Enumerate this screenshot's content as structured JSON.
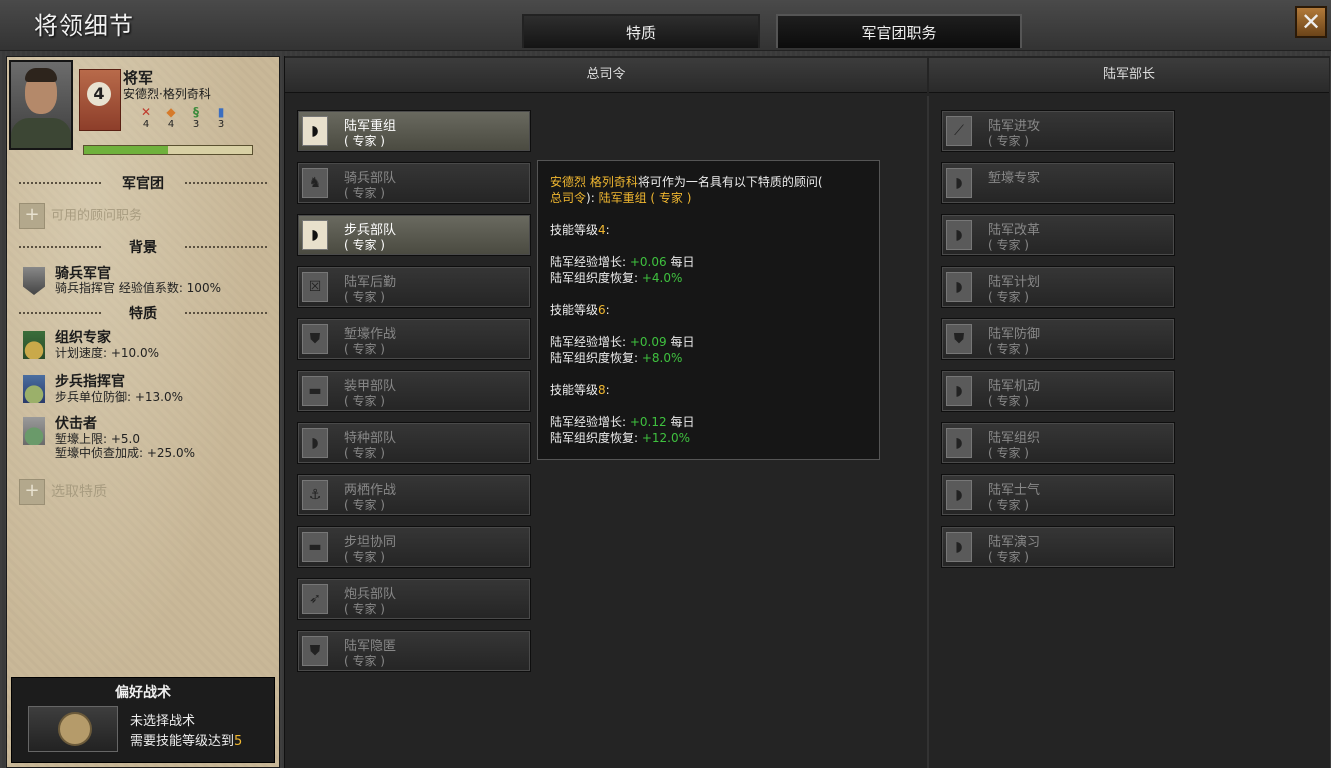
{
  "window": {
    "title": "将领细节",
    "tabs": [
      {
        "label": "特质"
      },
      {
        "label": "军官团职务"
      }
    ],
    "close_label": "✕"
  },
  "general": {
    "rank": "将军",
    "name": "安德烈·格列奇科",
    "rank_level": "4",
    "skills": [
      {
        "icon": "attack-icon",
        "value": "4",
        "color": "#c0392b"
      },
      {
        "icon": "defense-icon",
        "value": "4",
        "color": "#d67a2a"
      },
      {
        "icon": "planning-icon",
        "value": "3",
        "color": "#3b8a3b"
      },
      {
        "icon": "logistics-icon",
        "value": "3",
        "color": "#3b6ec0"
      }
    ],
    "xp_fraction": 0.5
  },
  "sections": {
    "officer_corps": "军官团",
    "available_advisor": "可用的顾问职务",
    "background": "背景",
    "traits": "特质",
    "pick_trait": "选取特质"
  },
  "background_item": {
    "name": "骑兵军官",
    "desc": "骑兵指挥官 经验值系数: 100%"
  },
  "traits": [
    {
      "name": "组织专家",
      "desc1": "计划速度: +10.0%",
      "desc2": ""
    },
    {
      "name": "步兵指挥官",
      "desc1": "步兵单位防御: +13.0%",
      "desc2": ""
    },
    {
      "name": "伏击者",
      "desc1": "堑壕上限: +5.0",
      "desc2": "堑壕中侦查加成: +25.0%"
    }
  ],
  "tactic": {
    "header": "偏好战术",
    "line1": "未选择战术",
    "line2_prefix": "需要技能等级达到",
    "line2_value": "5"
  },
  "columns": {
    "commander": "总司令",
    "army_chief": "陆军部长"
  },
  "commander_slots": [
    {
      "name": "陆军重组",
      "expert": "( 专家 )",
      "icon": "helmet-icon",
      "state": "selected"
    },
    {
      "name": "骑兵部队",
      "expert": "( 专家 )",
      "icon": "horse-icon",
      "state": "dim"
    },
    {
      "name": "步兵部队",
      "expert": "( 专家 )",
      "icon": "helmet-icon",
      "state": "selected"
    },
    {
      "name": "陆军后勤",
      "expert": "( 专家 )",
      "icon": "crate-icon",
      "state": "dim"
    },
    {
      "name": "堑壕作战",
      "expert": "( 专家 )",
      "icon": "shield-icon",
      "state": "dim"
    },
    {
      "name": "装甲部队",
      "expert": "( 专家 )",
      "icon": "tank-icon",
      "state": "dim"
    },
    {
      "name": "特种部队",
      "expert": "( 专家 )",
      "icon": "helmet-icon",
      "state": "dim"
    },
    {
      "name": "两栖作战",
      "expert": "( 专家 )",
      "icon": "anchor-icon",
      "state": "dim"
    },
    {
      "name": "步坦协同",
      "expert": "( 专家 )",
      "icon": "tank-icon",
      "state": "dim"
    },
    {
      "name": "炮兵部队",
      "expert": "( 专家 )",
      "icon": "artillery-icon",
      "state": "dim"
    },
    {
      "name": "陆军隐匿",
      "expert": "( 专家 )",
      "icon": "shield-icon",
      "state": "dim"
    }
  ],
  "army_chief_slots": [
    {
      "name": "陆军进攻",
      "expert": "( 专家 )",
      "icon": "sword-icon",
      "state": "dim"
    },
    {
      "name": "堑壕专家",
      "expert": "",
      "icon": "helmet-icon",
      "state": "dim"
    },
    {
      "name": "陆军改革",
      "expert": "( 专家 )",
      "icon": "helmet-icon",
      "state": "dim"
    },
    {
      "name": "陆军计划",
      "expert": "( 专家 )",
      "icon": "helmet-icon",
      "state": "dim"
    },
    {
      "name": "陆军防御",
      "expert": "( 专家 )",
      "icon": "shield-icon",
      "state": "dim"
    },
    {
      "name": "陆军机动",
      "expert": "( 专家 )",
      "icon": "helmet-icon",
      "state": "dim"
    },
    {
      "name": "陆军组织",
      "expert": "( 专家 )",
      "icon": "helmet-icon",
      "state": "dim"
    },
    {
      "name": "陆军士气",
      "expert": "( 专家 )",
      "icon": "helmet-icon",
      "state": "dim"
    },
    {
      "name": "陆军演习",
      "expert": "( 专家 )",
      "icon": "helmet-icon",
      "state": "dim"
    }
  ],
  "tooltip": {
    "line1_name": "安德烈 格列奇科",
    "line1_text": "将可作为一名具有以下特质的顾问(",
    "line2_role": "总司令",
    "line2_sep": "): ",
    "line2_trait": "陆军重组 ( 专家 )",
    "levels": [
      {
        "label": "技能等级",
        "level": "4",
        "xp_label": "陆军经验增长: ",
        "xp_val": "+0.06",
        "xp_suffix": " 每日",
        "org_label": "陆军组织度恢复: ",
        "org_val": "+4.0%"
      },
      {
        "label": "技能等级",
        "level": "6",
        "xp_label": "陆军经验增长: ",
        "xp_val": "+0.09",
        "xp_suffix": " 每日",
        "org_label": "陆军组织度恢复: ",
        "org_val": "+8.0%"
      },
      {
        "label": "技能等级",
        "level": "8",
        "xp_label": "陆军经验增长: ",
        "xp_val": "+0.12",
        "xp_suffix": " 每日",
        "org_label": "陆军组织度恢复: ",
        "org_val": "+12.0%"
      }
    ],
    "colon": ":"
  }
}
